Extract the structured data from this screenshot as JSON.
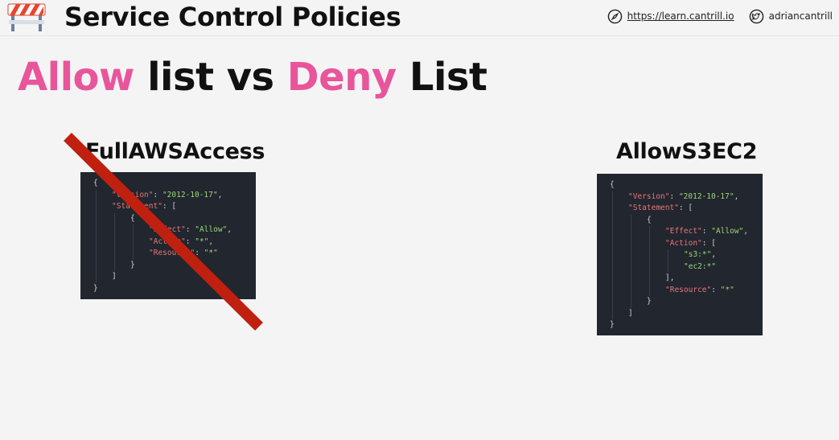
{
  "header": {
    "title": "Service Control Policies",
    "url": "https://learn.cantrill.io",
    "twitter": "adriancantrill"
  },
  "slide": {
    "title_allow": "Allow",
    "title_mid": " list vs ",
    "title_deny": "Deny",
    "title_end": " List"
  },
  "left_panel": {
    "title": "FullAWSAccess",
    "crossed_out": true,
    "code": [
      {
        "indent": 0,
        "parts": [
          [
            "p",
            "{"
          ]
        ]
      },
      {
        "indent": 1,
        "parts": [
          [
            "k",
            "\"Version\""
          ],
          [
            "p",
            ": "
          ],
          [
            "s",
            "\"2012-10-17\""
          ],
          [
            "p",
            ","
          ]
        ]
      },
      {
        "indent": 1,
        "parts": [
          [
            "k",
            "\"Statement\""
          ],
          [
            "p",
            ": ["
          ]
        ]
      },
      {
        "indent": 2,
        "parts": [
          [
            "p",
            "{"
          ]
        ]
      },
      {
        "indent": 3,
        "parts": [
          [
            "k",
            "\"Effect\""
          ],
          [
            "p",
            ": "
          ],
          [
            "s",
            "\"Allow\""
          ],
          [
            "p",
            ","
          ]
        ]
      },
      {
        "indent": 3,
        "parts": [
          [
            "k",
            "\"Action\""
          ],
          [
            "p",
            ": "
          ],
          [
            "s",
            "\"*\""
          ],
          [
            "p",
            ","
          ]
        ]
      },
      {
        "indent": 3,
        "parts": [
          [
            "k",
            "\"Resource\""
          ],
          [
            "p",
            ": "
          ],
          [
            "s",
            "\"*\""
          ]
        ]
      },
      {
        "indent": 2,
        "parts": [
          [
            "p",
            "}"
          ]
        ]
      },
      {
        "indent": 1,
        "parts": [
          [
            "p",
            "]"
          ]
        ]
      },
      {
        "indent": 0,
        "parts": [
          [
            "p",
            "}"
          ]
        ]
      }
    ]
  },
  "right_panel": {
    "title": "AllowS3EC2",
    "code": [
      {
        "indent": 0,
        "parts": [
          [
            "p",
            "{"
          ]
        ]
      },
      {
        "indent": 1,
        "parts": [
          [
            "k",
            "\"Version\""
          ],
          [
            "p",
            ": "
          ],
          [
            "s",
            "\"2012-10-17\""
          ],
          [
            "p",
            ","
          ]
        ]
      },
      {
        "indent": 1,
        "parts": [
          [
            "k",
            "\"Statement\""
          ],
          [
            "p",
            ": ["
          ]
        ]
      },
      {
        "indent": 2,
        "parts": [
          [
            "p",
            "{"
          ]
        ]
      },
      {
        "indent": 3,
        "parts": [
          [
            "k",
            "\"Effect\""
          ],
          [
            "p",
            ": "
          ],
          [
            "s",
            "\"Allow\""
          ],
          [
            "p",
            ","
          ]
        ]
      },
      {
        "indent": 3,
        "parts": [
          [
            "k",
            "\"Action\""
          ],
          [
            "p",
            ": ["
          ]
        ]
      },
      {
        "indent": 4,
        "parts": [
          [
            "s",
            "\"s3:*\""
          ],
          [
            "p",
            ","
          ]
        ]
      },
      {
        "indent": 4,
        "parts": [
          [
            "s",
            "\"ec2:*\""
          ]
        ]
      },
      {
        "indent": 3,
        "parts": [
          [
            "p",
            "],"
          ]
        ]
      },
      {
        "indent": 3,
        "parts": [
          [
            "k",
            "\"Resource\""
          ],
          [
            "p",
            ": "
          ],
          [
            "s",
            "\"*\""
          ]
        ]
      },
      {
        "indent": 2,
        "parts": [
          [
            "p",
            "}"
          ]
        ]
      },
      {
        "indent": 1,
        "parts": [
          [
            "p",
            "]"
          ]
        ]
      },
      {
        "indent": 0,
        "parts": [
          [
            "p",
            "}"
          ]
        ]
      }
    ]
  },
  "colors": {
    "accent_pink": "#e8559a",
    "cross_red": "#c0200f",
    "code_bg": "#22262e"
  },
  "icons": [
    "roadblock-icon",
    "compass-icon",
    "twitter-icon"
  ]
}
